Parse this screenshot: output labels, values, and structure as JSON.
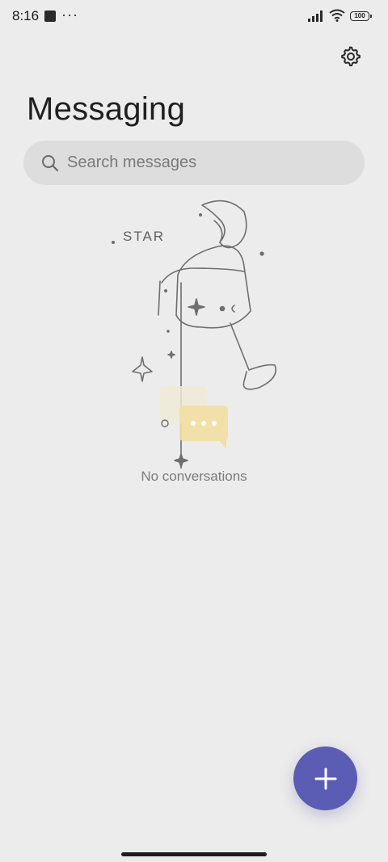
{
  "status_bar": {
    "time": "8:16",
    "more_indicator": "···",
    "battery_level": "100"
  },
  "header": {
    "title": "Messaging",
    "settings_icon": "gear-icon"
  },
  "search": {
    "placeholder": "Search messages",
    "value": ""
  },
  "empty_state": {
    "illustration_text": "STAR",
    "message": "No conversations"
  },
  "fab": {
    "icon": "plus-icon",
    "color": "#5b5db4"
  },
  "colors": {
    "background": "#ececec",
    "accent": "#5b5db4",
    "search_bg": "#dddddd"
  }
}
